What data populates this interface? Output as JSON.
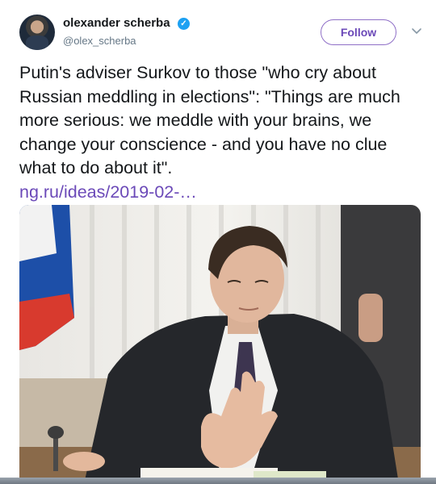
{
  "author": {
    "name": "olexander scherba",
    "handle": "@olex_scherba",
    "verified": true
  },
  "follow_label": "Follow",
  "tweet": {
    "text": "Putin's adviser Surkov to those \"who cry about Russian meddling in elections\": \"Things are much more serious: we meddle with your brains, we change your conscience - and you have no clue what to do about it\".",
    "link": "ng.ru/ideas/2019-02-…"
  },
  "icons": {
    "verified": "verified-badge-icon",
    "menu": "chevron-down-icon"
  },
  "colors": {
    "follow_accent": "#6b49b8",
    "link": "#6b49b8",
    "verified": "#1da1f2"
  }
}
